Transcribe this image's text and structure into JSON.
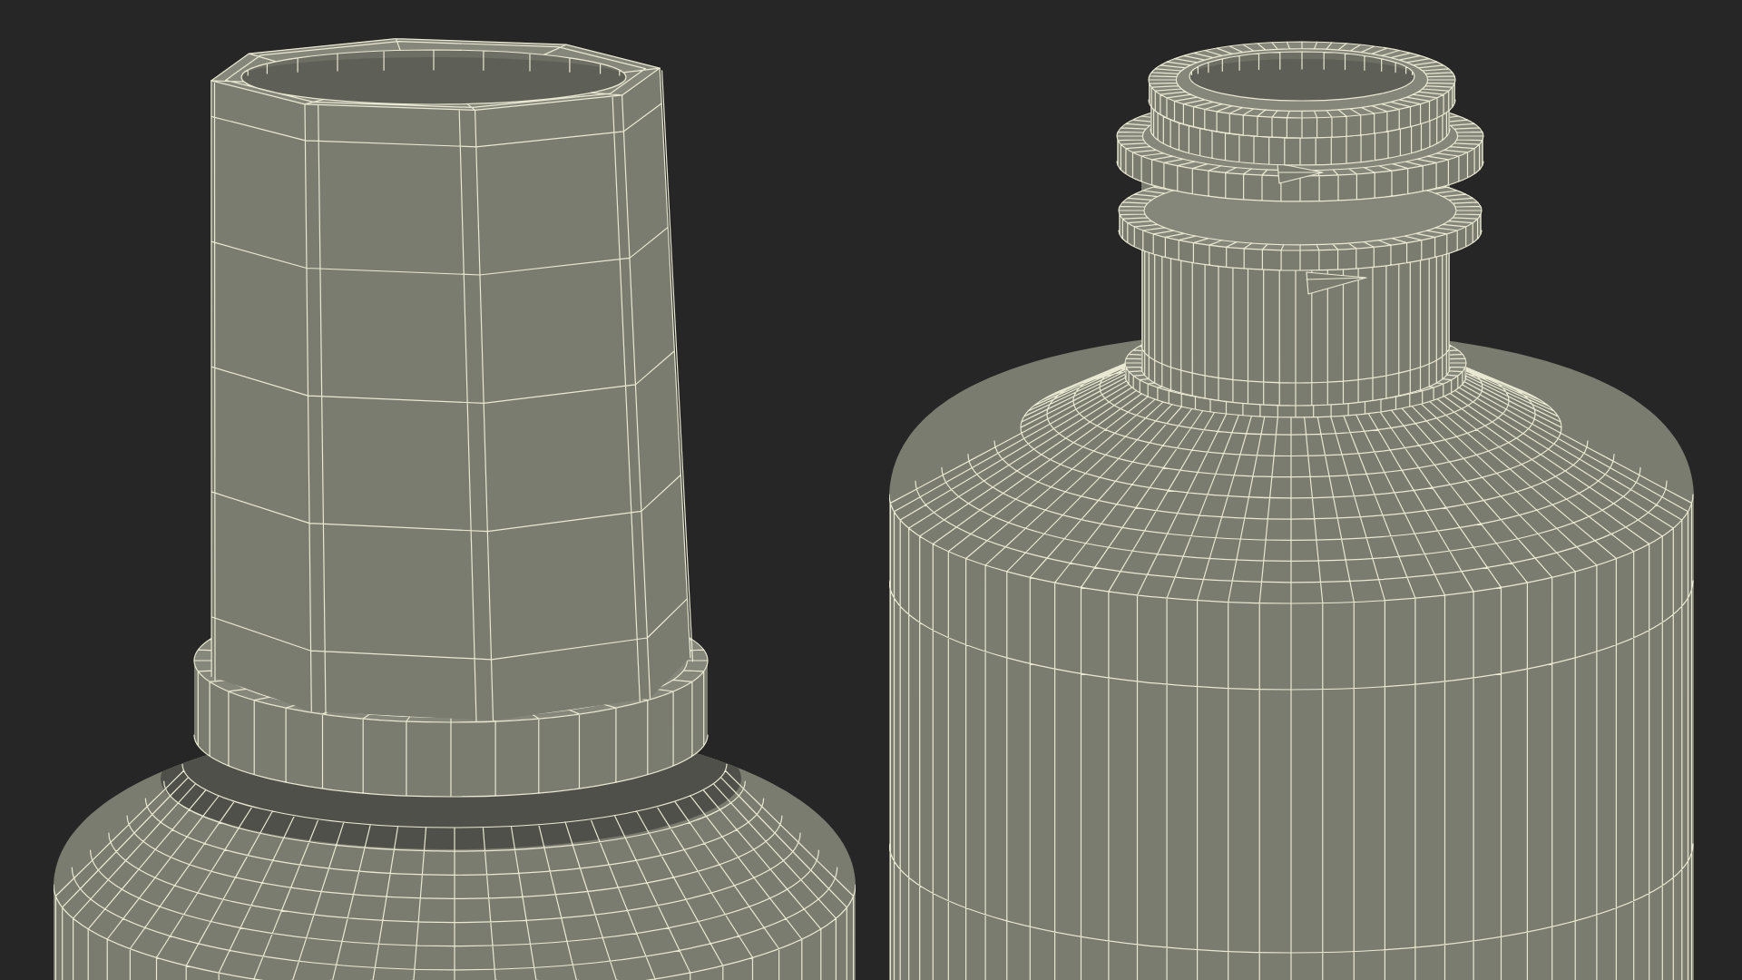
{
  "bottles": [
    {
      "kind": "octagonal-neck",
      "wireframe": true
    },
    {
      "kind": "threaded-neck",
      "wireframe": true
    }
  ]
}
